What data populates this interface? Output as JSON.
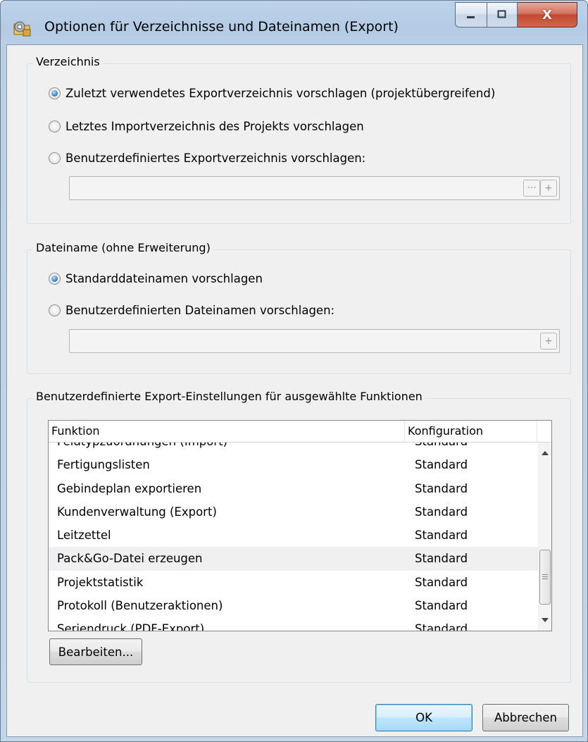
{
  "window": {
    "title": "Optionen für Verzeichnisse und Dateinamen (Export)",
    "icon": "settings-folder-icon",
    "caption_buttons": [
      "minimize-icon",
      "maximize-icon",
      "close-icon"
    ],
    "close_glyph": "X"
  },
  "verzeichnis": {
    "title": "Verzeichnis",
    "options": [
      {
        "label": "Zuletzt verwendetes Exportverzeichnis vorschlagen (projektübergreifend)",
        "checked": true
      },
      {
        "label": "Letztes Importverzeichnis des Projekts vorschlagen",
        "checked": false
      },
      {
        "label": "Benutzerdefiniertes Exportverzeichnis vorschlagen:",
        "checked": false
      }
    ],
    "path_value": "",
    "browse_label": "···",
    "add_label": "+"
  },
  "dateiname": {
    "title": "Dateiname (ohne Erweiterung)",
    "options": [
      {
        "label": "Standarddateinamen vorschlagen",
        "checked": true
      },
      {
        "label": "Benutzerdefinierten Dateinamen vorschlagen:",
        "checked": false
      }
    ],
    "name_value": "",
    "add_label": "+"
  },
  "export_settings": {
    "title": "Benutzerdefinierte Export-Einstellungen für ausgewählte Funktionen",
    "columns": [
      "Funktion",
      "Konfiguration"
    ],
    "rows": [
      {
        "funktion": "Feldtypzuordnungen (Import)",
        "konfiguration": "Standard"
      },
      {
        "funktion": "Fertigungslisten",
        "konfiguration": "Standard"
      },
      {
        "funktion": "Gebindeplan exportieren",
        "konfiguration": "Standard"
      },
      {
        "funktion": "Kundenverwaltung (Export)",
        "konfiguration": "Standard"
      },
      {
        "funktion": "Leitzettel",
        "konfiguration": "Standard"
      },
      {
        "funktion": "Pack&Go-Datei erzeugen",
        "konfiguration": "Standard"
      },
      {
        "funktion": "Projektstatistik",
        "konfiguration": "Standard"
      },
      {
        "funktion": "Protokoll (Benutzeraktionen)",
        "konfiguration": "Standard"
      },
      {
        "funktion": "Seriendruck (PDF-Export)",
        "konfiguration": "Standard"
      }
    ],
    "highlighted_row": "Pack&Go-Datei erzeugen",
    "edit_button": "Bearbeiten..."
  },
  "footer": {
    "ok": "OK",
    "cancel": "Abbrechen"
  }
}
